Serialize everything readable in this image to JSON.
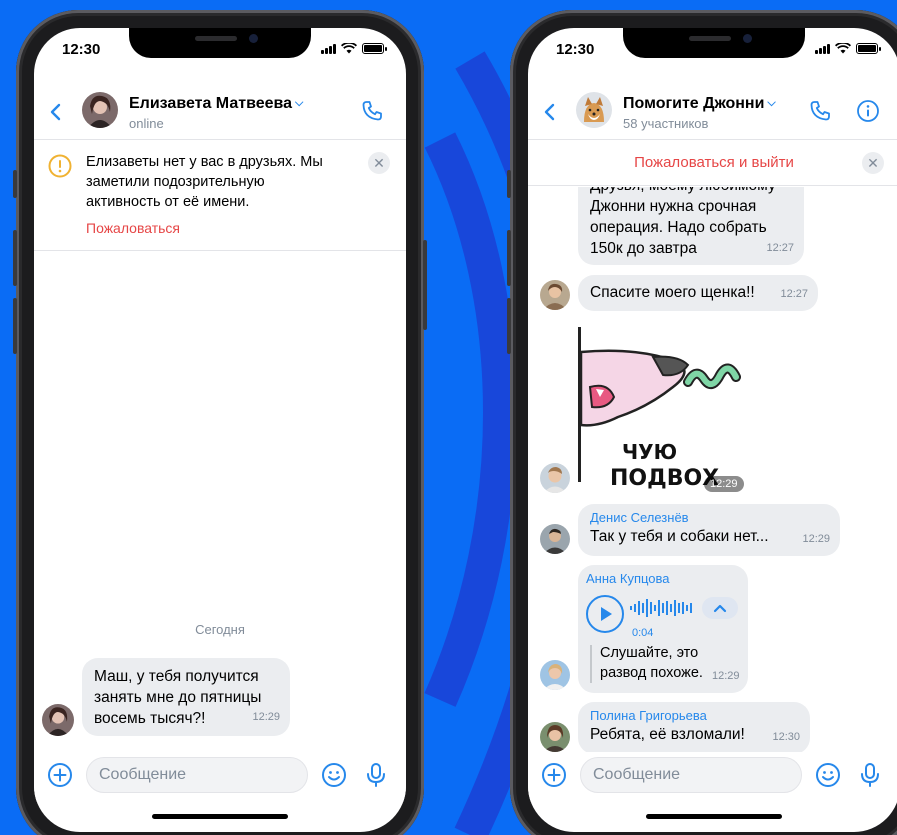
{
  "colors": {
    "background": "#0a6cf5",
    "accent": "#2688eb",
    "danger": "#e64646",
    "bubble": "#ebedf0",
    "muted": "#818c99"
  },
  "left": {
    "status_time": "12:30",
    "contact_name": "Елизавета Матвеева",
    "contact_status": "online",
    "warning": {
      "text": "Елизаветы нет у вас в друзьях. Мы заметили подозрительную активность от её имени.",
      "action": "Пожаловаться"
    },
    "date_separator": "Сегодня",
    "message": {
      "text": "Маш, у тебя получится занять мне до пятницы восемь тысяч?!",
      "time": "12:29"
    },
    "input_placeholder": "Сообщение"
  },
  "right": {
    "status_time": "12:30",
    "chat_title": "Помогите Джонни",
    "chat_members": "58 участников",
    "report_action": "Пожаловаться и выйти",
    "messages": [
      {
        "text": "Друзья, моему любимому Джонни нужна срочная операция. Надо собрать 150к до завтра",
        "time": "12:27"
      },
      {
        "text": "Спасите моего щенка!!",
        "time": "12:27"
      },
      {
        "sticker_text": "ЧУЮ ПОДВОХ",
        "time": "12:29"
      },
      {
        "sender": "Денис Селезнёв",
        "text": "Так у тебя и собаки нет...",
        "time": "12:29"
      },
      {
        "sender": "Анна Купцова",
        "audio_duration": "0:04",
        "text": "Слушайте, это развод похоже.",
        "time": "12:29"
      },
      {
        "sender": "Полина Григорьева",
        "text": "Ребята, её взломали!",
        "time": "12:30"
      }
    ],
    "input_placeholder": "Сообщение"
  },
  "icons": [
    "back-icon",
    "phone-icon",
    "info-icon",
    "warning-icon",
    "close-icon",
    "add-icon",
    "emoji-icon",
    "microphone-icon",
    "play-icon",
    "chevron-up-icon"
  ]
}
